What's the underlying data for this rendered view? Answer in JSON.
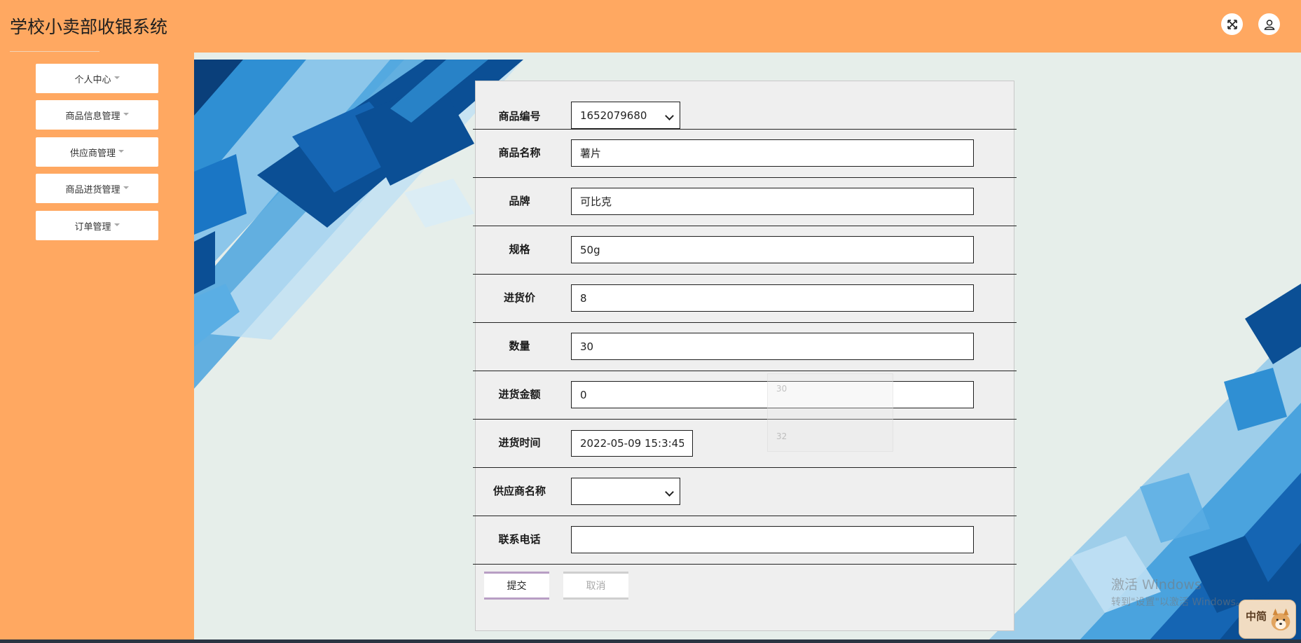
{
  "header": {
    "title": "学校小卖部收银系统",
    "fullscreen_icon": "expand-icon",
    "user_icon": "user-icon"
  },
  "sidebar": {
    "items": [
      {
        "label": "个人中心"
      },
      {
        "label": "商品信息管理"
      },
      {
        "label": "供应商管理"
      },
      {
        "label": "商品进货管理"
      },
      {
        "label": "订单管理"
      }
    ]
  },
  "form": {
    "fields": [
      {
        "label": "商品编号",
        "type": "select",
        "value": "1652079680"
      },
      {
        "label": "商品名称",
        "type": "text",
        "value": "薯片"
      },
      {
        "label": "品牌",
        "type": "text",
        "value": "可比克"
      },
      {
        "label": "规格",
        "type": "text",
        "value": "50g"
      },
      {
        "label": "进货价",
        "type": "text",
        "value": "8"
      },
      {
        "label": "数量",
        "type": "text",
        "value": "30"
      },
      {
        "label": "进货金额",
        "type": "text",
        "value": "0"
      },
      {
        "label": "进货时间",
        "type": "date",
        "value": "2022-05-09 15:3:45"
      },
      {
        "label": "供应商名称",
        "type": "select",
        "value": ""
      },
      {
        "label": "联系电话",
        "type": "text",
        "value": ""
      }
    ],
    "autocomplete": [
      "30",
      "32"
    ],
    "submit_label": "提交",
    "cancel_label": "取消"
  },
  "watermark": {
    "line1": "激活 Windows",
    "line2": "转到\"设置\"以激活 Windows。"
  },
  "ime": {
    "label": "中简"
  },
  "colors": {
    "header_bg": "#ffa861",
    "content_bg": "#e6eeea",
    "panel_bg": "#efefef",
    "submit_accent": "#b89ec4",
    "art_dark": "#0b4f95",
    "art_mid": "#2f8fd3",
    "art_light": "#8cc6ea"
  }
}
